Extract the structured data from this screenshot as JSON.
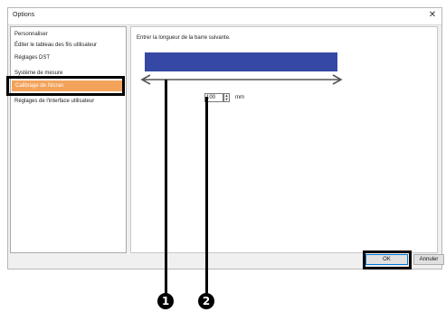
{
  "window": {
    "title": "Options",
    "close_symbol": "✕"
  },
  "sidebar": {
    "items": [
      {
        "label": "Personnaliser"
      },
      {
        "label": "Éditer le tableau des fils utilisateur"
      },
      {
        "label": "Réglages DST"
      },
      {
        "label": "Système de mesure"
      },
      {
        "label": "Calibrage de l'écran"
      },
      {
        "label": "Réglages de l'interface utilisateur"
      }
    ],
    "selected_index": 4
  },
  "panel": {
    "instruction": "Entrer la longueur de la barre suivante.",
    "length_value": "100",
    "unit": "mm"
  },
  "buttons": {
    "ok": "OK",
    "cancel": "Annuler"
  },
  "callouts": [
    "1",
    "2"
  ],
  "colors": {
    "preview_bar": "#3548a4",
    "selection": "#f3a35a"
  }
}
